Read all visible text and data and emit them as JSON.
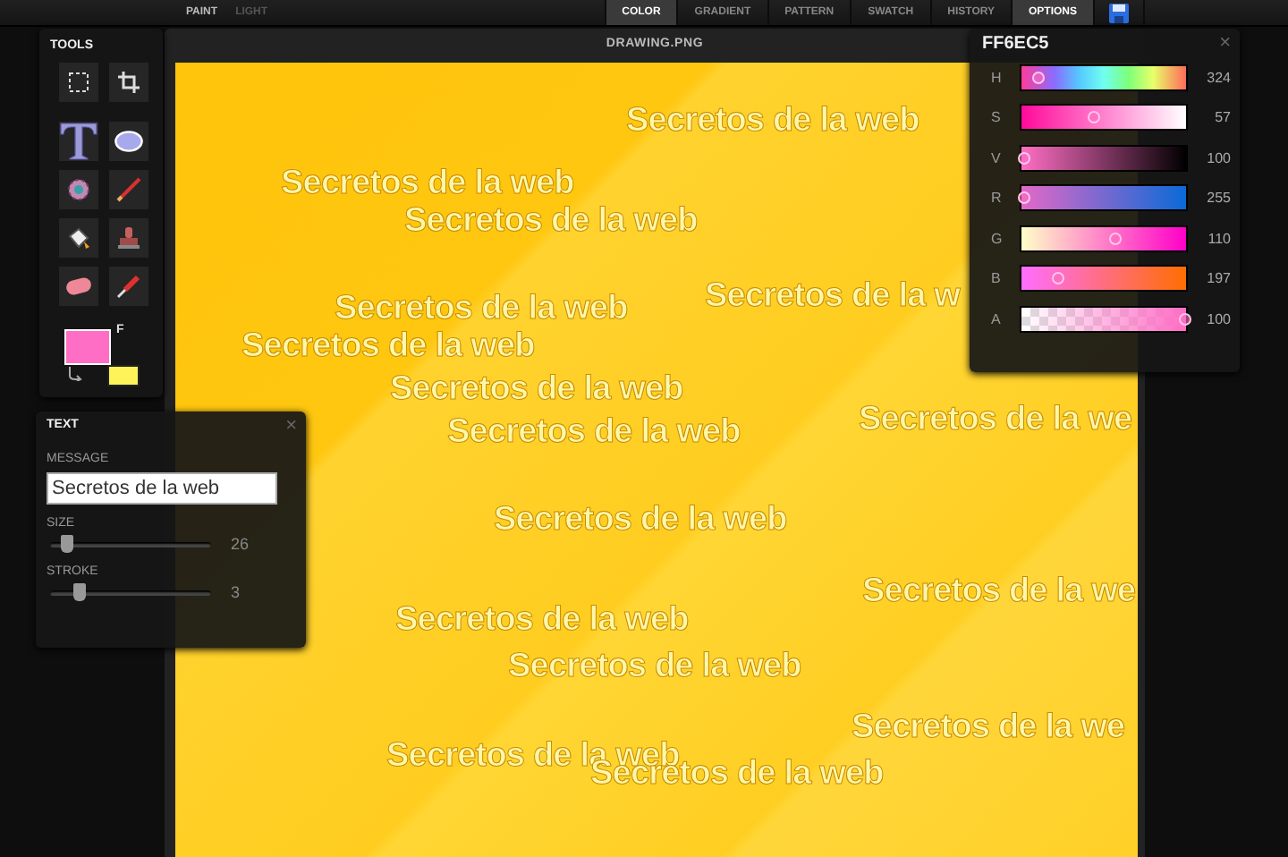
{
  "modes": [
    {
      "label": "PAINT",
      "selected": true
    },
    {
      "label": "LIGHT",
      "selected": false
    }
  ],
  "tabs": [
    {
      "label": "COLOR",
      "selected": true
    },
    {
      "label": "GRADIENT",
      "selected": false
    },
    {
      "label": "PATTERN",
      "selected": false
    },
    {
      "label": "SWATCH",
      "selected": false
    },
    {
      "label": "HISTORY",
      "selected": false
    },
    {
      "label": "OPTIONS",
      "selected": true
    }
  ],
  "tools_panel": {
    "title": "TOOLS",
    "tools": [
      {
        "kind": "select"
      },
      {
        "kind": "crop"
      },
      {
        "kind": "text"
      },
      {
        "kind": "ellipse"
      },
      {
        "kind": "gear"
      },
      {
        "kind": "brush"
      },
      {
        "kind": "fill"
      },
      {
        "kind": "stamp"
      },
      {
        "kind": "eraser"
      },
      {
        "kind": "picker"
      }
    ],
    "swap_label": "F"
  },
  "canvas_window": {
    "title": "DRAWING.PNG",
    "texts": [
      "Secretos de la web",
      "Secretos de la web",
      "Secretos de la web",
      "Secretos de la w",
      "Secretos de la web",
      "Secretos de la web",
      "Secretos de la web",
      "Secretos de la we",
      "Secretos de la web",
      "Secretos de la web",
      "Secretos de la we",
      "Secretos de la web",
      "Secretos de la web",
      "Secretos de la we",
      "Secretos de la web",
      "Secretos de la web"
    ]
  },
  "text_panel": {
    "title": "TEXT",
    "close": "×",
    "message_label": "MESSAGE",
    "message": "Secretos de la web",
    "sliders": [
      {
        "label": "SIZE",
        "level": 0.1,
        "reading": "26"
      },
      {
        "label": "STROKE",
        "level": 0.18,
        "reading": "3"
      }
    ]
  },
  "color_panel": {
    "title": "FF6EC5",
    "close": "×",
    "channels": [
      {
        "label": "H",
        "level": 0.1,
        "reading": "324",
        "kind": "hue"
      },
      {
        "label": "S",
        "level": 0.43,
        "reading": "57",
        "kind": "sat"
      },
      {
        "label": "V",
        "level": 0.01,
        "reading": "100",
        "kind": "val"
      },
      {
        "label": "R",
        "level": 0.01,
        "reading": "255",
        "kind": "red"
      },
      {
        "label": "G",
        "level": 0.57,
        "reading": "110",
        "kind": "green"
      },
      {
        "label": "B",
        "level": 0.22,
        "reading": "197",
        "kind": "blue"
      },
      {
        "label": "A",
        "level": 0.99,
        "reading": "100",
        "kind": "alpha"
      }
    ]
  }
}
